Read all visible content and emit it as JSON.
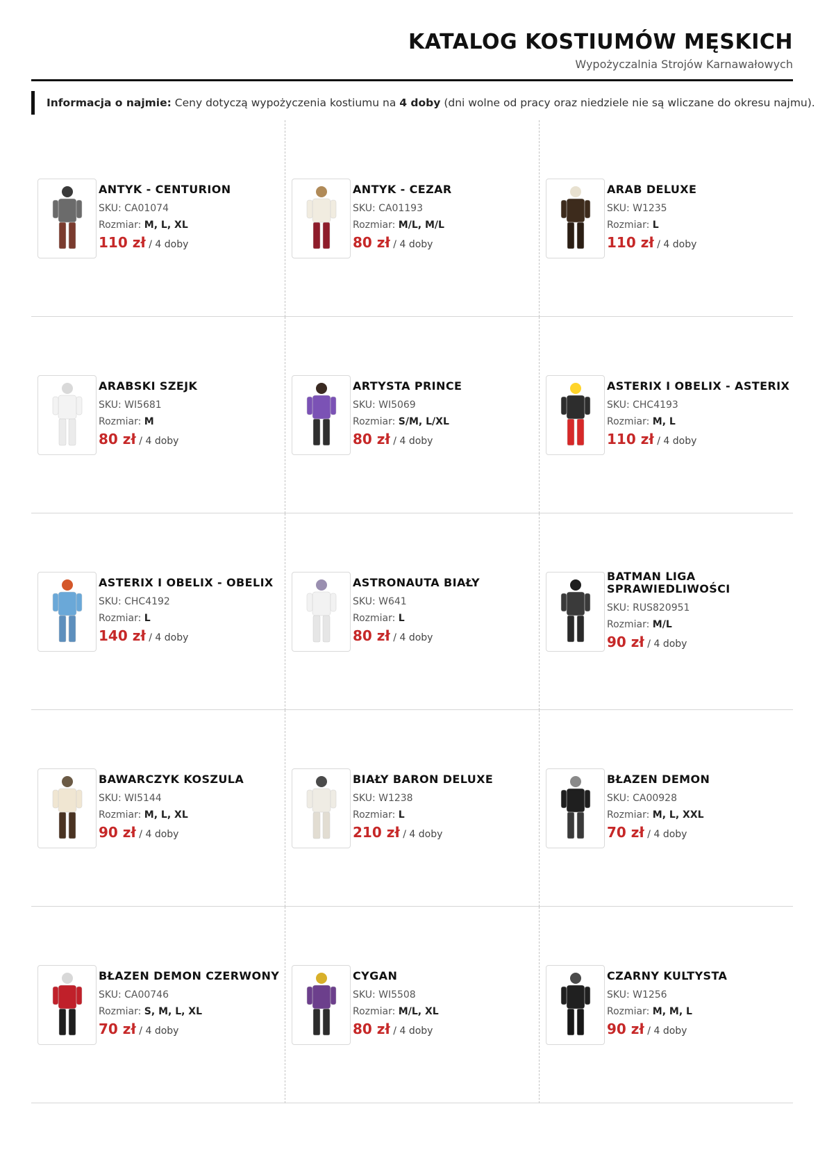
{
  "header": {
    "title": "KATALOG KOSTIUMÓW MĘSKICH",
    "subtitle": "Wypożyczalnia Strojów Karnawałowych"
  },
  "info": {
    "label": "Informacja o najmie:",
    "text_before": "Ceny dotyczą wypożyczenia kostiumu na",
    "highlight": "4 doby",
    "text_after": "(dni wolne od pracy oraz niedziele nie są wliczane do okresu najmu)."
  },
  "labels": {
    "sku": "SKU: ",
    "size": "Rozmiar: ",
    "period": " / 4 doby"
  },
  "products": [
    {
      "name": "ANTYK - CENTURION",
      "sku": "CA01074",
      "sizes": "M, L, XL",
      "price": "110 zł",
      "icon": "centurion-costume-icon",
      "colors": {
        "top": "#6b6b6b",
        "bottom": "#7a3b2e",
        "head": "#3a3a3a"
      }
    },
    {
      "name": "ANTYK - CEZAR",
      "sku": "CA01193",
      "sizes": "M/L, M/L",
      "price": "80 zł",
      "icon": "caesar-costume-icon",
      "colors": {
        "top": "#f1ece0",
        "bottom": "#8e1c2a",
        "head": "#b08a58"
      }
    },
    {
      "name": "ARAB DELUXE",
      "sku": "W1235",
      "sizes": "L",
      "price": "110 zł",
      "icon": "arab-costume-icon",
      "colors": {
        "top": "#3d2b1c",
        "bottom": "#2b1e14",
        "head": "#e8e1d0"
      }
    },
    {
      "name": "ARABSKI SZEJK",
      "sku": "WI5681",
      "sizes": "M",
      "price": "80 zł",
      "icon": "sheikh-costume-icon",
      "colors": {
        "top": "#f3f3f3",
        "bottom": "#ebebeb",
        "head": "#d9d9d9"
      }
    },
    {
      "name": "ARTYSTA PRINCE",
      "sku": "WI5069",
      "sizes": "S/M, L/XL",
      "price": "80 zł",
      "icon": "prince-costume-icon",
      "colors": {
        "top": "#7b52b5",
        "bottom": "#2f2f2f",
        "head": "#3a2a22"
      }
    },
    {
      "name": "ASTERIX I OBELIX - ASTERIX",
      "sku": "CHC4193",
      "sizes": "M, L",
      "price": "110 zł",
      "icon": "asterix-costume-icon",
      "colors": {
        "top": "#2d2d2d",
        "bottom": "#d62828",
        "head": "#ffd42a"
      }
    },
    {
      "name": "ASTERIX I OBELIX - OBELIX",
      "sku": "CHC4192",
      "sizes": "L",
      "price": "140 zł",
      "icon": "obelix-costume-icon",
      "colors": {
        "top": "#6aa8d8",
        "bottom": "#5d8fbd",
        "head": "#d4572a"
      }
    },
    {
      "name": "ASTRONAUTA BIAŁY",
      "sku": "W641",
      "sizes": "L",
      "price": "80 zł",
      "icon": "astronaut-costume-icon",
      "colors": {
        "top": "#f2f2f2",
        "bottom": "#e6e6e6",
        "head": "#9a8fb0"
      }
    },
    {
      "name": "BATMAN LIGA SPRAWIEDLIWOŚCI",
      "sku": "RUS820951",
      "sizes": "M/L",
      "price": "90 zł",
      "icon": "batman-costume-icon",
      "colors": {
        "top": "#3a3a3a",
        "bottom": "#2a2a2a",
        "head": "#1e1e1e"
      }
    },
    {
      "name": "BAWARCZYK KOSZULA",
      "sku": "WI5144",
      "sizes": "M, L, XL",
      "price": "90 zł",
      "icon": "bavarian-costume-icon",
      "colors": {
        "top": "#f0e6d2",
        "bottom": "#4a3322",
        "head": "#6b5a45"
      }
    },
    {
      "name": "BIAŁY BARON DELUXE",
      "sku": "W1238",
      "sizes": "L",
      "price": "210 zł",
      "icon": "white-baron-costume-icon",
      "colors": {
        "top": "#efece4",
        "bottom": "#e2ddd2",
        "head": "#4a4a4a"
      }
    },
    {
      "name": "BŁAZEN DEMON",
      "sku": "CA00928",
      "sizes": "M, L, XXL",
      "price": "70 zł",
      "icon": "demon-jester-costume-icon",
      "colors": {
        "top": "#1f1f1f",
        "bottom": "#3a3a3a",
        "head": "#8a8a8a"
      }
    },
    {
      "name": "BŁAZEN DEMON CZERWONY",
      "sku": "CA00746",
      "sizes": "S, M, L, XL",
      "price": "70 zł",
      "icon": "red-demon-jester-costume-icon",
      "colors": {
        "top": "#c0202a",
        "bottom": "#1e1e1e",
        "head": "#d8d8d8"
      }
    },
    {
      "name": "CYGAN",
      "sku": "WI5508",
      "sizes": "M/L, XL",
      "price": "80 zł",
      "icon": "gypsy-costume-icon",
      "colors": {
        "top": "#6c3f8c",
        "bottom": "#2c2c2c",
        "head": "#d8b02a"
      }
    },
    {
      "name": "CZARNY KULTYSTA",
      "sku": "W1256",
      "sizes": "M, M, L",
      "price": "90 zł",
      "icon": "black-cultist-costume-icon",
      "colors": {
        "top": "#202020",
        "bottom": "#181818",
        "head": "#4a4a4a"
      }
    }
  ]
}
